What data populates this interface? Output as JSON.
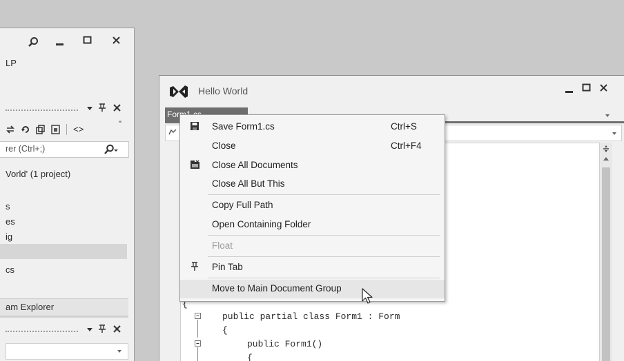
{
  "left_window": {
    "menu_fragment": "LP",
    "search_placeholder": "rer (Ctrl+;)",
    "solution_label": "Vorld' (1 project)",
    "tree_items": [
      "s",
      "es",
      "ig",
      "",
      "cs"
    ],
    "team_explorer_tab": "am Explorer",
    "more_glyph": "\"",
    "code_icon_glyph": "<>"
  },
  "main_window": {
    "title": "Hello World",
    "document_tab": "Form1.cs",
    "code_lines": [
      "{",
      "public partial class Form1 : Form",
      "{",
      "public Form1()",
      "{"
    ]
  },
  "context_menu": {
    "items": [
      {
        "label": "Save Form1.cs",
        "shortcut": "Ctrl+S",
        "icon": "save-icon"
      },
      {
        "label": "Close",
        "shortcut": "Ctrl+F4"
      },
      {
        "label": "Close All Documents",
        "icon": "close-all-documents-icon"
      },
      {
        "label": "Close All But This"
      },
      {
        "label": "Copy Full Path"
      },
      {
        "label": "Open Containing Folder"
      },
      {
        "label": "Float",
        "disabled": true
      },
      {
        "label": "Pin Tab",
        "icon": "pin-icon"
      },
      {
        "label": "Move to Main Document Group",
        "hovered": true
      }
    ]
  },
  "colors": {
    "desktop": "#c9c9c9",
    "window": "#f0f0f0",
    "menu": "#f5f5f5",
    "tab_active": "#6e6e6e",
    "selection": "#d6d6d6"
  }
}
